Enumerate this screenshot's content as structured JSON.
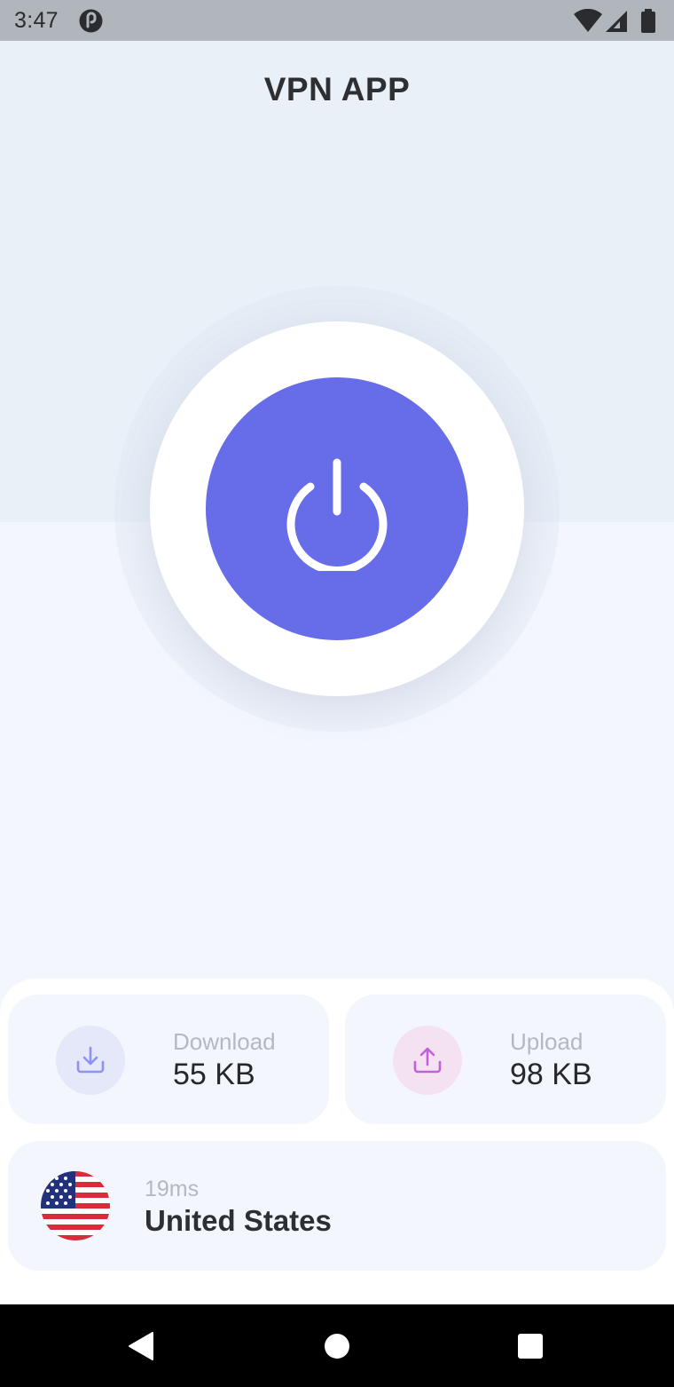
{
  "status_bar": {
    "time": "3:47",
    "icons": [
      "app-notification-icon",
      "wifi-icon",
      "cell-signal-icon",
      "battery-icon"
    ]
  },
  "header": {
    "title": "VPN APP"
  },
  "power": {
    "icon": "power-icon",
    "accent_color": "#676ce9"
  },
  "stats": {
    "download": {
      "label": "Download",
      "value": "55 KB",
      "icon": "download-icon",
      "color": "#8c92f0"
    },
    "upload": {
      "label": "Upload",
      "value": "98 KB",
      "icon": "upload-icon",
      "color": "#c25fdc"
    }
  },
  "server": {
    "latency": "19ms",
    "country": "United States",
    "flag": "us-flag-icon"
  },
  "nav": {
    "icons": [
      "back-icon",
      "home-icon",
      "recents-icon"
    ]
  }
}
